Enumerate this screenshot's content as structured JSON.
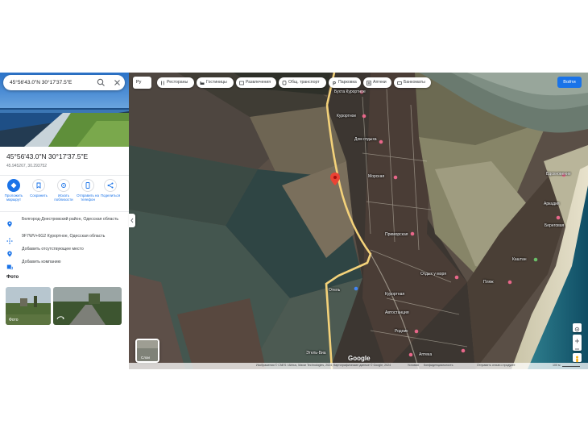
{
  "search": {
    "value": "45°56'43.0\"N 30°17'37.5\"E",
    "search_icon": "search-icon",
    "close_icon": "close-icon"
  },
  "place": {
    "title": "45°56'43.0\"N 30°17'37.5\"E",
    "decimal": "45.945267, 30.293752"
  },
  "actions": [
    {
      "label": "Проложить маршрут",
      "icon": "directions-icon"
    },
    {
      "label": "Сохранить",
      "icon": "bookmark-icon"
    },
    {
      "label": "Искать поблизости",
      "icon": "nearby-icon"
    },
    {
      "label": "Отправить на телефон",
      "icon": "phone-icon"
    },
    {
      "label": "Поделиться",
      "icon": "share-icon"
    }
  ],
  "info": {
    "address": "Белгород-Днестровский район, Одесская область",
    "plus_code": "9F7WV+6G2 Курортное, Одесская область",
    "add_place": "Добавить отсутствующее место",
    "add_business": "Добавить компанию"
  },
  "photos": {
    "title": "Фото",
    "items": [
      {
        "caption": "Фото"
      },
      {
        "caption": ""
      }
    ]
  },
  "map": {
    "language": "Ру",
    "chips": [
      {
        "label": "Рестораны",
        "icon": "restaurant-icon"
      },
      {
        "label": "Гостиницы",
        "icon": "hotel-icon"
      },
      {
        "label": "Развлечения",
        "icon": "entertainment-icon"
      },
      {
        "label": "Общ. транспорт",
        "icon": "transit-icon"
      },
      {
        "label": "Парковка",
        "icon": "parking-icon"
      },
      {
        "label": "Аптеки",
        "icon": "pharmacy-icon"
      },
      {
        "label": "Банкоматы",
        "icon": "atm-icon"
      }
    ],
    "signin": "Войти",
    "layers_caption": "Слои",
    "google": "Google",
    "pois": [
      "Бухта Курортное",
      "Курортное",
      "Дом отдыха",
      "Морская",
      "Приморская",
      "Пляж",
      "Курортная",
      "Родник",
      "Автостанция",
      "Отель",
      "Отдых у моря",
      "Аптека",
      "Этель-Виа",
      "Вдохновение",
      "Аркадия",
      "Береговая",
      "Каштан"
    ],
    "footer": {
      "imagery": "Изображения © CNES / Airbus, Maxar Technologies, 2024; Картографические данные © Google, 2024",
      "terms": "Условия",
      "privacy": "Конфиденциальность",
      "feedback": "Отправить отзыв о продукте",
      "scale": "100 м"
    }
  },
  "colors": {
    "accent": "#1a73e8",
    "pin": "#ea4335",
    "road": "#f4d27a"
  }
}
